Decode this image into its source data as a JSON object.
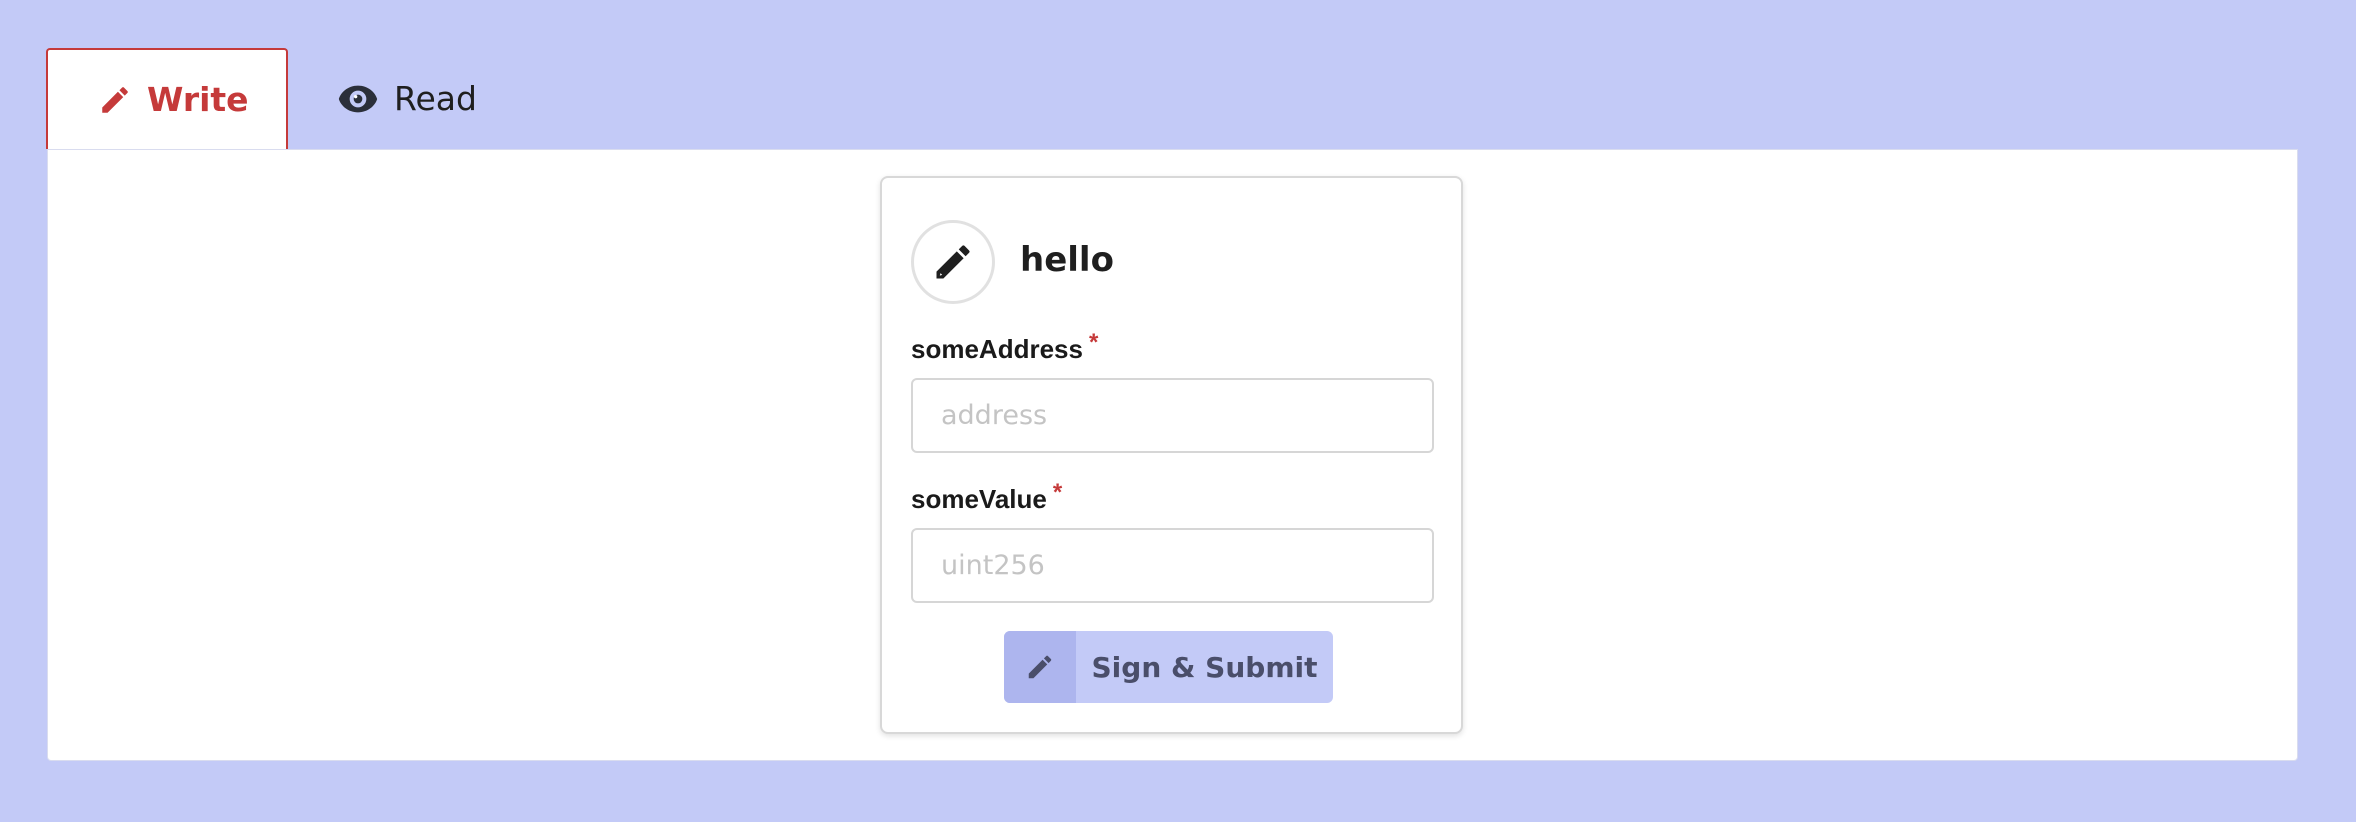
{
  "tabs": [
    {
      "label": "Write",
      "icon": "pencil-icon",
      "active": true,
      "color": "#c53a3a"
    },
    {
      "label": "Read",
      "icon": "eye-icon",
      "active": false
    }
  ],
  "form": {
    "title": "hello",
    "icon": "pencil-icon",
    "fields": [
      {
        "label": "someAddress",
        "required_mark": "*",
        "placeholder": "address",
        "value": ""
      },
      {
        "label": "someValue",
        "required_mark": "*",
        "placeholder": "uint256",
        "value": ""
      }
    ],
    "submit": {
      "label": "Sign & Submit",
      "icon": "pencil-icon"
    }
  },
  "colors": {
    "background": "#c3caf7",
    "accent": "#c53a3a",
    "button": "#c3caf7",
    "button_icon_bg": "#adb5ee"
  }
}
